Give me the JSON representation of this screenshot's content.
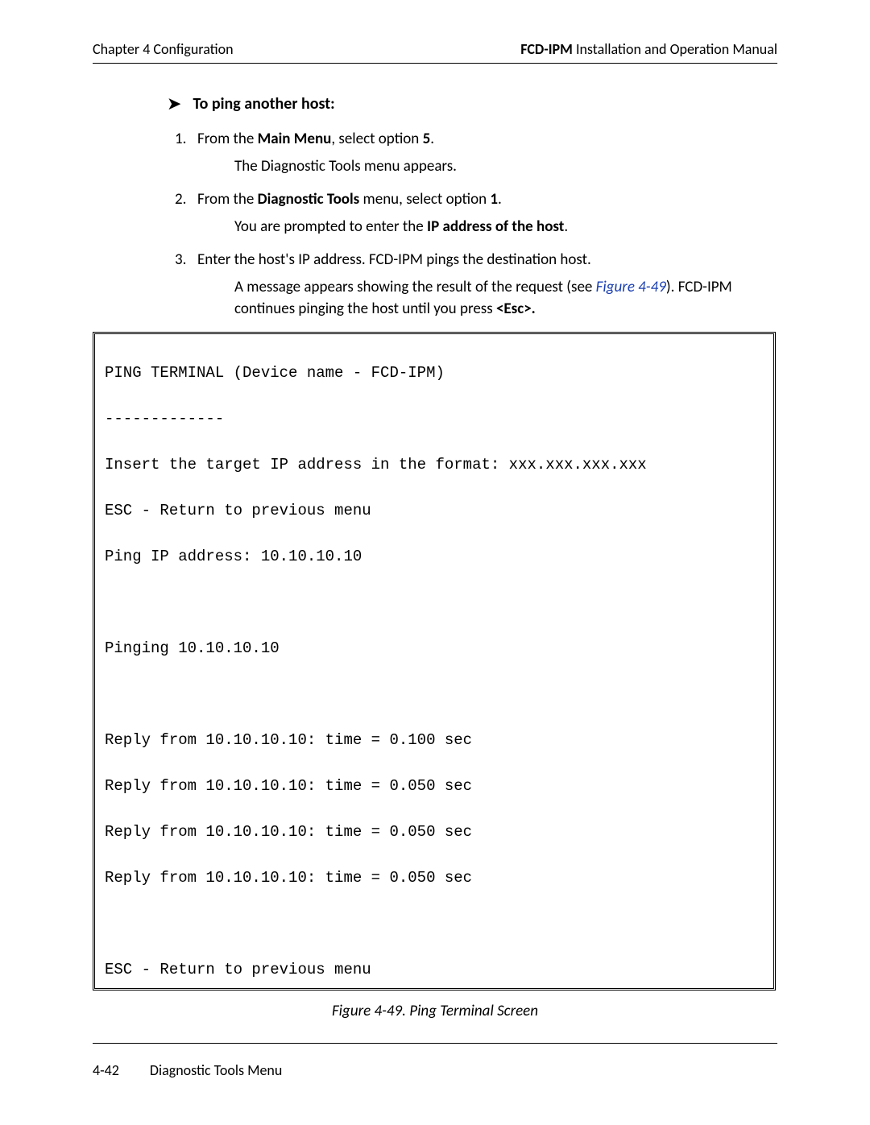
{
  "header": {
    "left": "Chapter 4  Configuration",
    "right_bold": "FCD-IPM",
    "right_rest": " Installation and Operation Manual"
  },
  "task": {
    "title": "To ping another host:"
  },
  "steps": [
    {
      "num_pre": "From the ",
      "bold1": "Main Menu",
      "mid": ", select option ",
      "bold2": "5",
      "post": ".",
      "sub1": "The Diagnostic Tools menu appears."
    },
    {
      "num_pre": "From the ",
      "bold1": "Diagnostic Tools",
      "mid": " menu, select option ",
      "bold2": "1",
      "post": ".",
      "sub1_pre": "You are prompted to enter the ",
      "sub1_bold": "IP address of the host",
      "sub1_post": "."
    },
    {
      "line": "Enter the host's IP address. FCD-IPM pings the destination host.",
      "sub1_pre": "A message appears showing the result of the request (see ",
      "sub1_link": "Figure 4-49",
      "sub1_post": "). FCD-IPM continues pinging the host until you press ",
      "sub1_bold": "<Esc>."
    }
  ],
  "terminal": {
    "l1": "PING TERMINAL (Device name - FCD-IPM)",
    "l2": "-------------",
    "l3": "Insert the target IP address in the format: xxx.xxx.xxx.xxx",
    "l4": "ESC - Return to previous menu",
    "l5": "Ping IP address: 10.10.10.10",
    "blank1": " ",
    "l6": "Pinging 10.10.10.10",
    "blank2": " ",
    "l7": "Reply from 10.10.10.10: time = 0.100 sec",
    "l8": "Reply from 10.10.10.10: time = 0.050 sec",
    "l9": "Reply from 10.10.10.10: time = 0.050 sec",
    "l10": "Reply from 10.10.10.10: time = 0.050 sec",
    "blank3": " ",
    "l11": "ESC - Return to previous menu"
  },
  "figure_caption": "Figure 4-49.  Ping Terminal Screen",
  "footer": {
    "pagenum": "4-42",
    "title": "Diagnostic Tools Menu"
  }
}
